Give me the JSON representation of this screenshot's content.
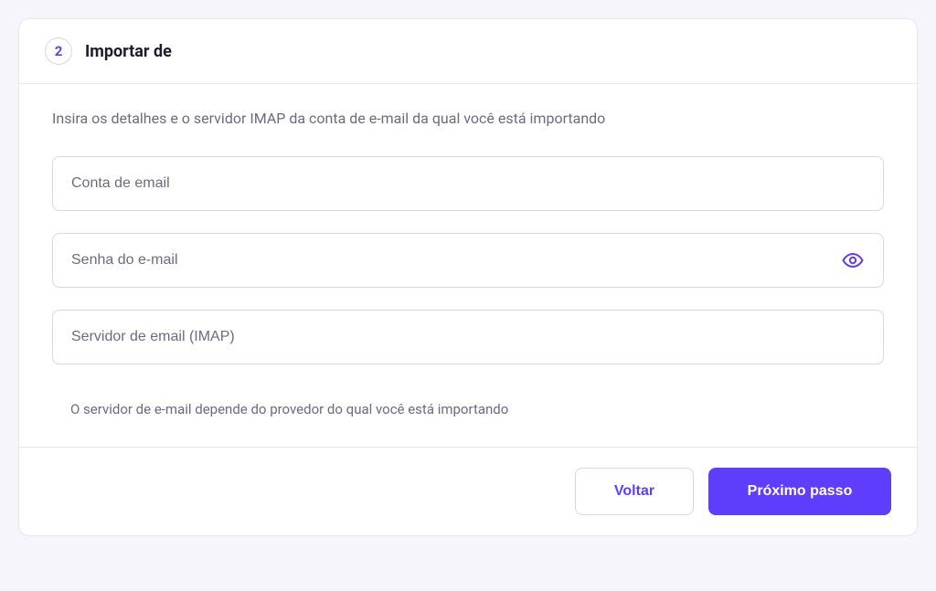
{
  "header": {
    "step_number": "2",
    "title": "Importar de"
  },
  "body": {
    "instruction": "Insira os detalhes e o servidor IMAP da conta de e-mail da qual você está importando",
    "fields": {
      "email_account": {
        "placeholder": "Conta de email",
        "value": ""
      },
      "email_password": {
        "placeholder": "Senha do e-mail",
        "value": ""
      },
      "email_server": {
        "placeholder": "Servidor de email (IMAP)",
        "value": ""
      }
    },
    "helper_text": "O servidor de e-mail depende do provedor do qual você está importando"
  },
  "footer": {
    "back_label": "Voltar",
    "next_label": "Próximo passo"
  }
}
